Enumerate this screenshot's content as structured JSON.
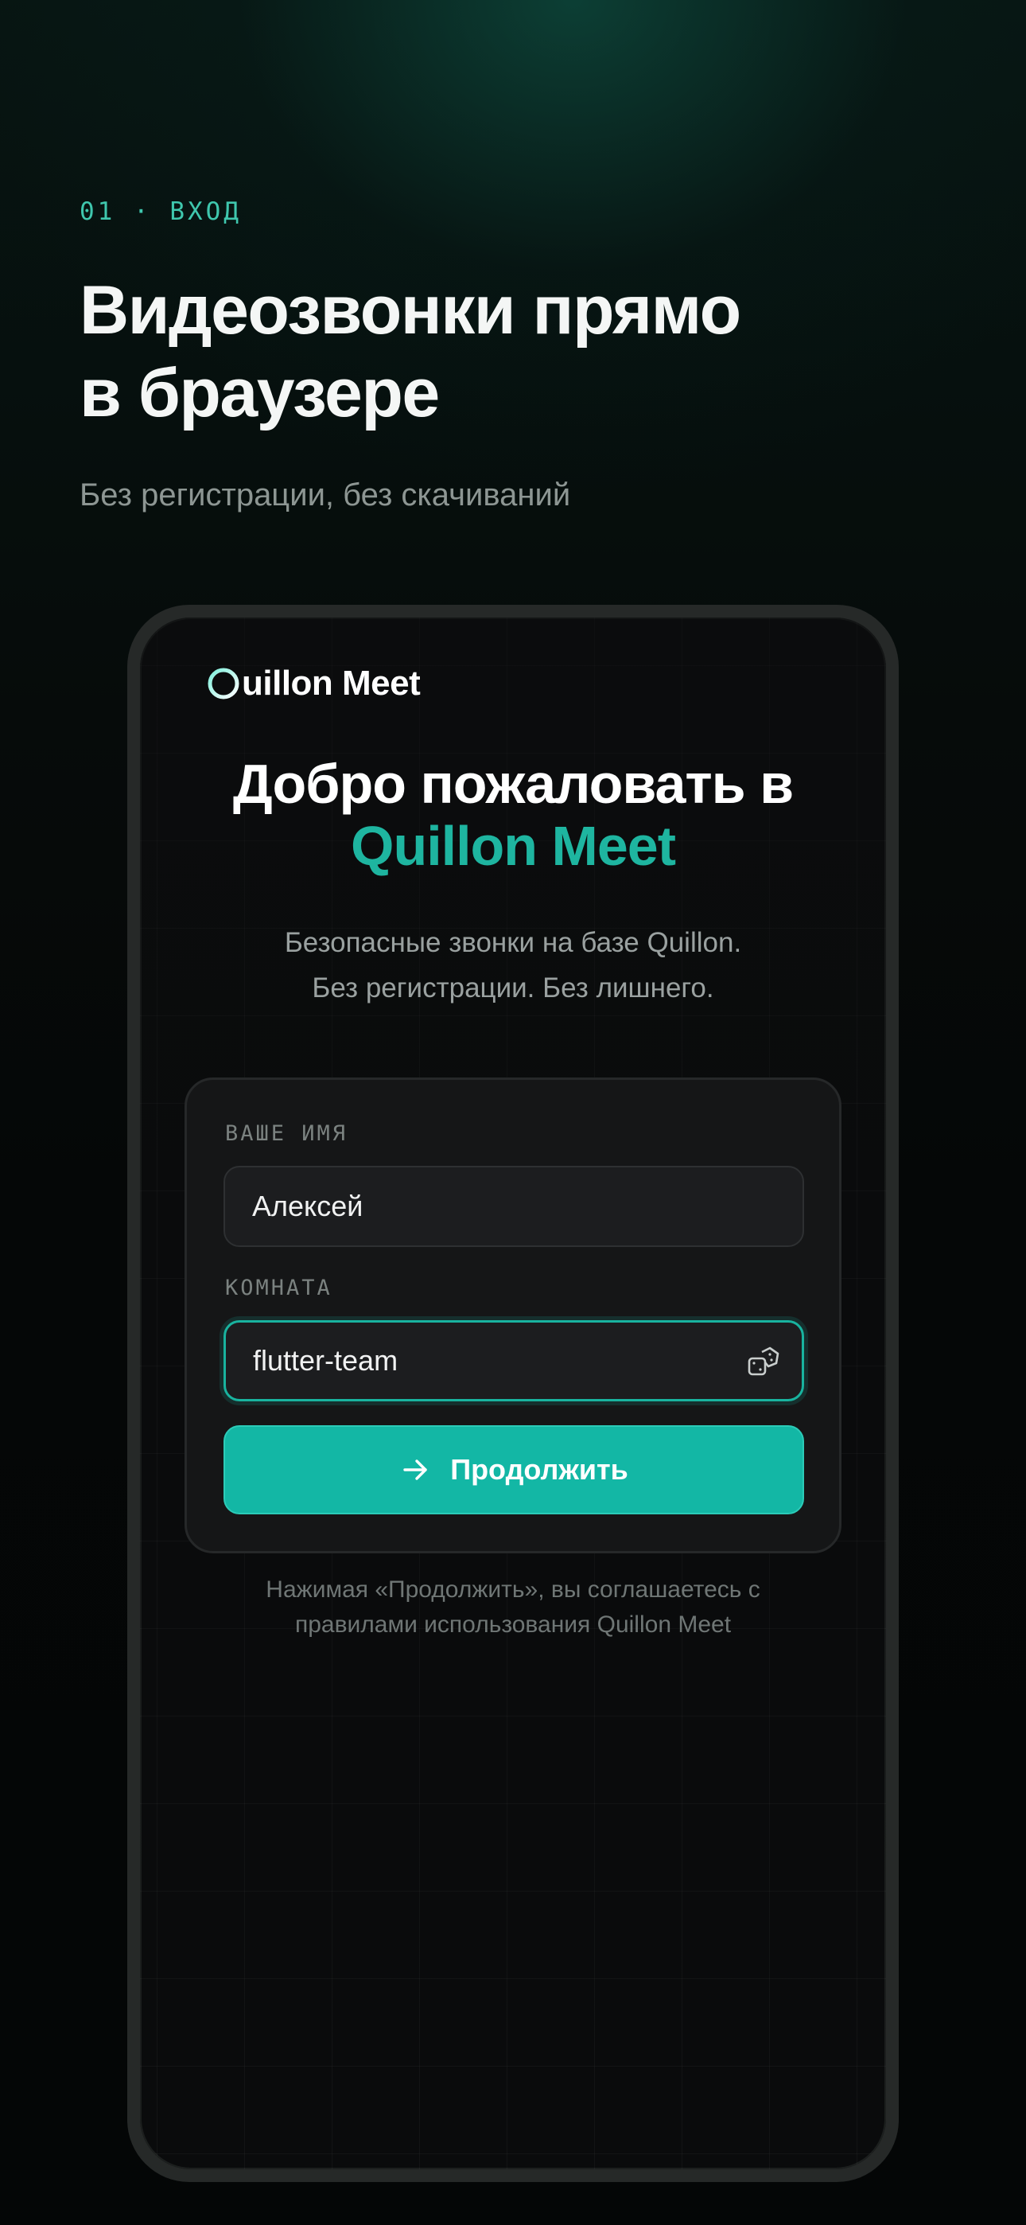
{
  "intro": {
    "step_label": "01 · ВХОД",
    "title_line1": "Видеозвонки прямо",
    "title_line2": "в браузере",
    "subtitle": "Без регистрации, без скачиваний"
  },
  "app": {
    "logo_text": "uillon Meet",
    "logo_icon": "o-ring-logo-icon",
    "welcome_line1": "Добро пожаловать в",
    "welcome_line2": "Quillon Meet",
    "description_line1": "Безопасные звонки на базе Quillon.",
    "description_line2": "Без регистрации. Без лишнего."
  },
  "form": {
    "name_label": "ВАШЕ ИМЯ",
    "name_value": "Алексей",
    "room_label": "КОМНАТА",
    "room_value": "flutter-team",
    "room_action_icon": "dice-icon",
    "continue_label": "Продолжить",
    "continue_icon": "arrow-right-icon"
  },
  "terms": {
    "line1": "Нажимая «Продолжить», вы соглашаетесь с",
    "line2": "правилами использования Quillon Meet"
  },
  "colors": {
    "accent": "#13b7a5",
    "accent_text": "#1eb5a0",
    "step_label": "#3fc7ae",
    "background": "#050707",
    "card": "#151617"
  }
}
